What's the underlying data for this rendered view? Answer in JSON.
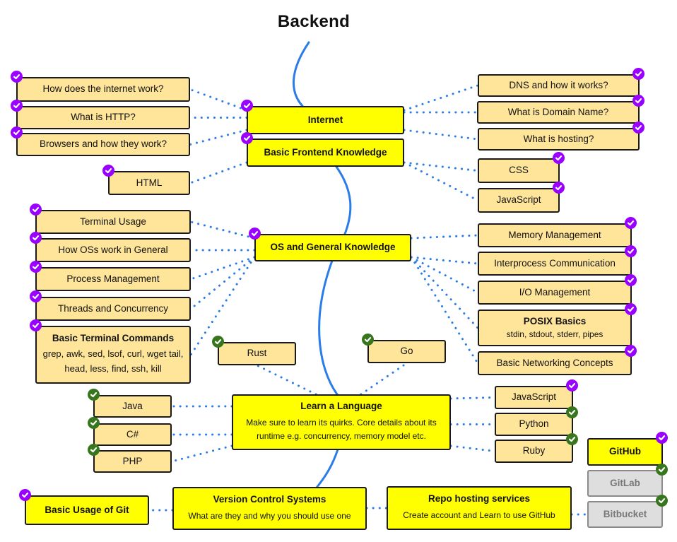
{
  "title": "Backend",
  "colors": {
    "topic": "#ffff00",
    "subtopic": "#ffe599",
    "alternative": "#dedede",
    "connector": "#2b7ce9",
    "check_done": "#9900ff",
    "check_alt": "#38761d"
  },
  "nodes": [
    {
      "id": "internet",
      "type": "topic",
      "label": "Internet",
      "check": "done"
    },
    {
      "id": "frontend",
      "type": "topic",
      "label": "Basic Frontend Knowledge",
      "check": "done"
    },
    {
      "id": "os",
      "type": "topic",
      "label": "OS and General Knowledge",
      "check": "done"
    },
    {
      "id": "language",
      "type": "topic",
      "label": "Learn a Language",
      "description": "Make sure to learn its quirks. Core details about its runtime e.g. concurrency, memory model etc.",
      "check": "none"
    },
    {
      "id": "vcs",
      "type": "topic",
      "label": "Version Control Systems",
      "description": "What are they and why you should use one",
      "check": "none"
    },
    {
      "id": "repo",
      "type": "topic",
      "label": "Repo hosting services",
      "description": "Create account and Learn to use GitHub",
      "check": "none"
    },
    {
      "id": "git",
      "type": "topic",
      "label": "Basic Usage of Git",
      "check": "done"
    },
    {
      "id": "github",
      "type": "topic",
      "label": "GitHub",
      "check": "done"
    },
    {
      "id": "gitlab",
      "type": "alt",
      "label": "GitLab",
      "check": "alt"
    },
    {
      "id": "bitbucket",
      "type": "alt",
      "label": "Bitbucket",
      "check": "alt"
    },
    {
      "id": "how-internet",
      "type": "sub",
      "label": "How does the internet work?",
      "check": "done"
    },
    {
      "id": "http",
      "type": "sub",
      "label": "What is HTTP?",
      "check": "done"
    },
    {
      "id": "browsers",
      "type": "sub",
      "label": "Browsers and how they work?",
      "check": "done"
    },
    {
      "id": "html",
      "type": "sub",
      "label": "HTML",
      "check": "done"
    },
    {
      "id": "dns",
      "type": "sub",
      "label": "DNS and how it works?",
      "check": "done"
    },
    {
      "id": "domain",
      "type": "sub",
      "label": "What is Domain Name?",
      "check": "done"
    },
    {
      "id": "hosting",
      "type": "sub",
      "label": "What is hosting?",
      "check": "done"
    },
    {
      "id": "css",
      "type": "sub",
      "label": "CSS",
      "check": "done"
    },
    {
      "id": "js-frontend",
      "type": "sub",
      "label": "JavaScript",
      "check": "done"
    },
    {
      "id": "terminal",
      "type": "sub",
      "label": "Terminal Usage",
      "check": "done"
    },
    {
      "id": "how-os",
      "type": "sub",
      "label": "How OSs work in General",
      "check": "done"
    },
    {
      "id": "process",
      "type": "sub",
      "label": "Process Management",
      "check": "done"
    },
    {
      "id": "threads",
      "type": "sub",
      "label": "Threads and Concurrency",
      "check": "done"
    },
    {
      "id": "commands",
      "type": "sub",
      "label": "Basic Terminal Commands",
      "description": "grep, awk, sed, lsof, curl, wget tail, head, less, find, ssh, kill",
      "check": "done"
    },
    {
      "id": "memory",
      "type": "sub",
      "label": "Memory Management",
      "check": "done"
    },
    {
      "id": "ipc",
      "type": "sub",
      "label": "Interprocess Communication",
      "check": "done"
    },
    {
      "id": "io",
      "type": "sub",
      "label": "I/O Management",
      "check": "done"
    },
    {
      "id": "posix",
      "type": "sub",
      "label": "POSIX Basics",
      "description": "stdin, stdout, stderr, pipes",
      "check": "done"
    },
    {
      "id": "networking",
      "type": "sub",
      "label": "Basic Networking Concepts",
      "check": "done"
    },
    {
      "id": "rust",
      "type": "sub",
      "label": "Rust",
      "check": "alt"
    },
    {
      "id": "go",
      "type": "sub",
      "label": "Go",
      "check": "alt"
    },
    {
      "id": "java",
      "type": "sub",
      "label": "Java",
      "check": "alt"
    },
    {
      "id": "csharp",
      "type": "sub",
      "label": "C#",
      "check": "alt"
    },
    {
      "id": "php",
      "type": "sub",
      "label": "PHP",
      "check": "alt"
    },
    {
      "id": "js-lang",
      "type": "sub",
      "label": "JavaScript",
      "check": "done"
    },
    {
      "id": "python",
      "type": "sub",
      "label": "Python",
      "check": "alt"
    },
    {
      "id": "ruby",
      "type": "sub",
      "label": "Ruby",
      "check": "alt"
    }
  ],
  "edges": [
    [
      "internet",
      "how-internet"
    ],
    [
      "internet",
      "http"
    ],
    [
      "internet",
      "browsers"
    ],
    [
      "internet",
      "dns"
    ],
    [
      "internet",
      "domain"
    ],
    [
      "internet",
      "hosting"
    ],
    [
      "frontend",
      "html"
    ],
    [
      "frontend",
      "css"
    ],
    [
      "frontend",
      "js-frontend"
    ],
    [
      "os",
      "terminal"
    ],
    [
      "os",
      "how-os"
    ],
    [
      "os",
      "process"
    ],
    [
      "os",
      "threads"
    ],
    [
      "os",
      "commands"
    ],
    [
      "os",
      "memory"
    ],
    [
      "os",
      "ipc"
    ],
    [
      "os",
      "io"
    ],
    [
      "os",
      "posix"
    ],
    [
      "os",
      "networking"
    ],
    [
      "language",
      "rust"
    ],
    [
      "language",
      "go"
    ],
    [
      "language",
      "java"
    ],
    [
      "language",
      "csharp"
    ],
    [
      "language",
      "php"
    ],
    [
      "language",
      "js-lang"
    ],
    [
      "language",
      "python"
    ],
    [
      "language",
      "ruby"
    ],
    [
      "vcs",
      "git"
    ],
    [
      "vcs",
      "repo"
    ],
    [
      "repo",
      "bitbucket"
    ]
  ]
}
